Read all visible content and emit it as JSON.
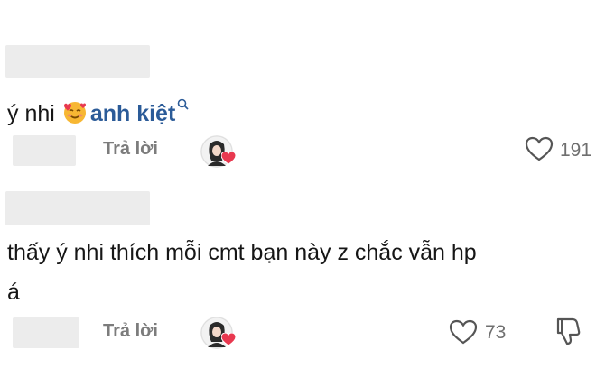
{
  "comments": [
    {
      "text_name": "ý nhi",
      "mention": "anh kiệt",
      "reply_label": "Trả lời",
      "like_count": "191",
      "icons": [
        "smiling-face-with-hearts-icon",
        "magnifier-icon",
        "heart-outline-icon"
      ]
    },
    {
      "text_line1": "thấy ý nhi thích mỗi cmt bạn này z chắc vẫn hp",
      "text_line2": "á",
      "reply_label": "Trả lời",
      "like_count": "73",
      "icons": [
        "heart-outline-icon",
        "dislike-icon"
      ]
    }
  ],
  "colors": {
    "mention": "#2b5b98",
    "secondary_text": "#7c7c7c",
    "heart_badge": "#e8384f",
    "redacted": "#ececec"
  }
}
